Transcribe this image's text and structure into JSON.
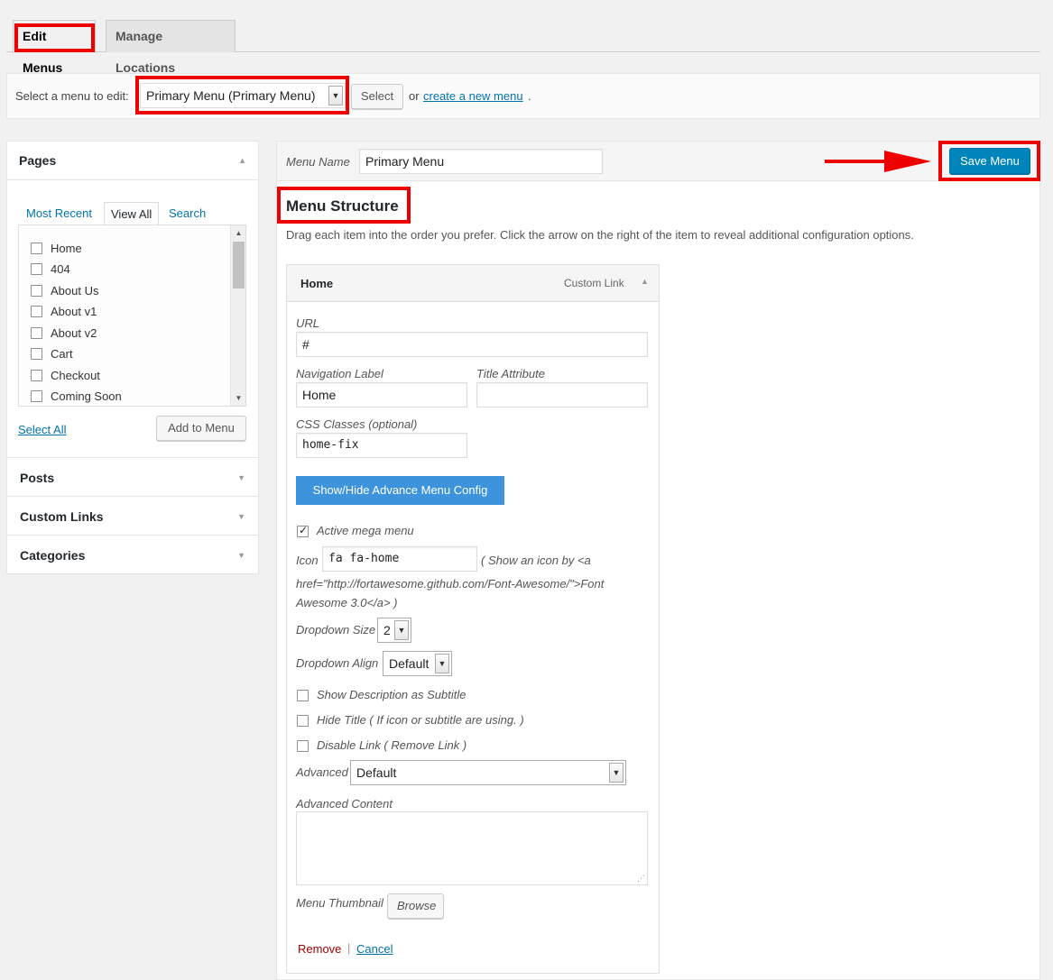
{
  "tabs": {
    "edit_menus": "Edit Menus",
    "manage_locations": "Manage Locations"
  },
  "select_bar": {
    "label": "Select a menu to edit:",
    "selected_menu": "Primary Menu (Primary Menu)",
    "select_button": "Select",
    "or_text": "or",
    "create_link": "create a new menu",
    "period": "."
  },
  "left": {
    "pages_title": "Pages",
    "page_tabs": [
      "Most Recent",
      "View All",
      "Search"
    ],
    "pages": [
      "Home",
      "404",
      "About Us",
      "About v1",
      "About v2",
      "Cart",
      "Checkout",
      "Coming Soon"
    ],
    "select_all": "Select All",
    "add_to_menu": "Add to Menu",
    "sections": [
      "Posts",
      "Custom Links",
      "Categories"
    ]
  },
  "menu_header": {
    "label": "Menu Name",
    "value": "Primary Menu",
    "save_button": "Save Menu"
  },
  "structure": {
    "title": "Menu Structure",
    "description": "Drag each item into the order you prefer. Click the arrow on the right of the item to reveal additional configuration options."
  },
  "item": {
    "title": "Home",
    "type": "Custom Link",
    "url_label": "URL",
    "url_value": "#",
    "nav_label": "Navigation Label",
    "nav_value": "Home",
    "title_attr_label": "Title Attribute",
    "title_attr_value": "",
    "css_label": "CSS Classes (optional)",
    "css_value": "home-fix",
    "advance_button": "Show/Hide Advance Menu Config",
    "active_mega": "Active mega menu",
    "icon_label": "Icon",
    "icon_value": "fa fa-home",
    "icon_help_1": "( Show an icon by <a",
    "icon_help_2": "href=\"http://fortawesome.github.com/Font-Awesome/\">Font",
    "icon_help_3": "Awesome 3.0</a> )",
    "dropdown_size_label": "Dropdown Size",
    "dropdown_size_value": "2",
    "dropdown_align_label": "Dropdown Align",
    "dropdown_align_value": "Default",
    "show_desc": "Show Description as Subtitle",
    "hide_title": "Hide Title ( If icon or subtitle are using. )",
    "disable_link": "Disable Link ( Remove Link )",
    "advanced_label": "Advanced",
    "advanced_value": "Default",
    "advanced_content_label": "Advanced Content",
    "thumbnail_label": "Menu Thumbnail",
    "browse_button": "Browse",
    "remove_link": "Remove",
    "separator": "|",
    "cancel_link": "Cancel"
  },
  "colors": {
    "primary": "#0085ba",
    "annotation_red": "#ee0000",
    "advance_button": "#3e94dc",
    "remove_red": "#a00000"
  }
}
